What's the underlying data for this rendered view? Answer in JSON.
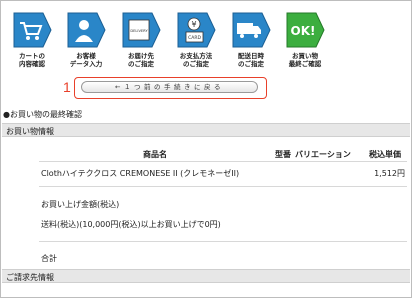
{
  "steps": [
    {
      "label": "カートの\n内容確認",
      "icon": "cart-icon",
      "color": "#2a86c8"
    },
    {
      "label": "お客様\nデータ入力",
      "icon": "person-icon",
      "color": "#2a86c8"
    },
    {
      "label": "お届け先\nのご指定",
      "icon": "delivery-box-icon",
      "color": "#2a86c8"
    },
    {
      "label": "お支払方法\nのご指定",
      "icon": "card-coin-icon",
      "color": "#2a86c8"
    },
    {
      "label": "配送日時\nのご指定",
      "icon": "truck-icon",
      "color": "#2a86c8"
    },
    {
      "label": "お買い物\n最終ご確認",
      "icon": "ok-icon",
      "color": "#3cae3f",
      "badge": "OK!"
    }
  ],
  "icon_texts": {
    "coin": "¥",
    "card": "CARD",
    "box": "DELIVERY"
  },
  "back": {
    "marker": "1",
    "label": "←１つ前の手続きに戻る"
  },
  "page_title": "●お買い物の最終確認",
  "section_purchase": "お買い物情報",
  "columns": {
    "product": "商品名",
    "model": "型番",
    "variation": "バリエーション",
    "price": "税込単価"
  },
  "item": {
    "name": "Clothハイテククロス CREMONESE II (クレモネーゼII)",
    "price": "1,512円"
  },
  "total_label": "お買い上げ金額(税込)",
  "shipping": "送料(税込)(10,000円(税込)以上お買い上げで0円)",
  "sum_label": "合計",
  "section_billing": "ご請求先情報",
  "colors": {
    "accent_red": "#e8402a",
    "step_blue": "#2a86c8",
    "step_green": "#3cae3f",
    "bar_gray": "#e7e7e7"
  }
}
